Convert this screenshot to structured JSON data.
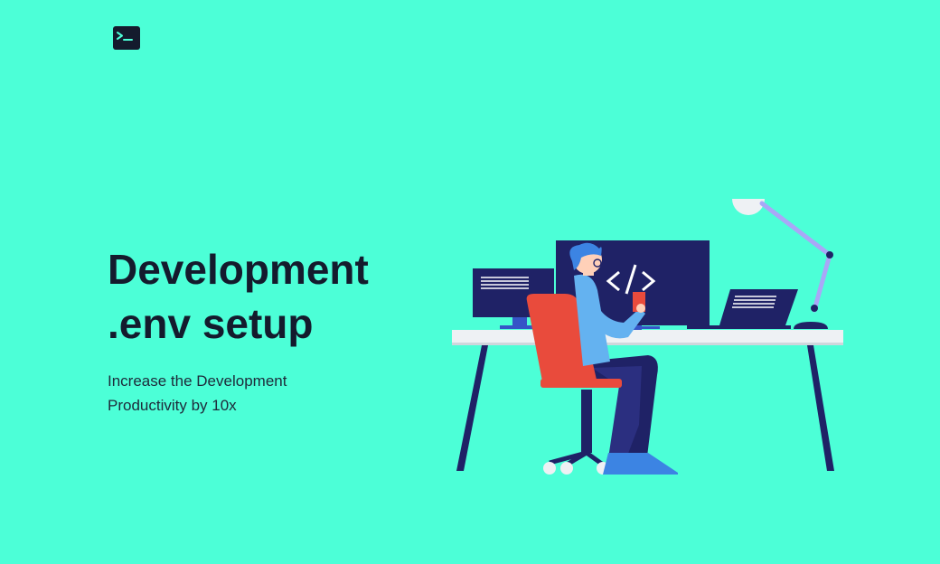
{
  "brand": {
    "icon": "terminal-icon",
    "color": "#141b2d"
  },
  "hero": {
    "title_line1": "Development",
    "title_line2": ".env setup",
    "subtitle": "Increase the Development Productivity by 10x"
  },
  "illustration": {
    "icon": "developer-desk-illustration",
    "code_glyph": "</>"
  },
  "colors": {
    "background": "#4cffd7",
    "navy": "#1f2266",
    "chair_red": "#e94b3c",
    "shirt_blue": "#64b2f0",
    "desk": "#eef1f4"
  }
}
